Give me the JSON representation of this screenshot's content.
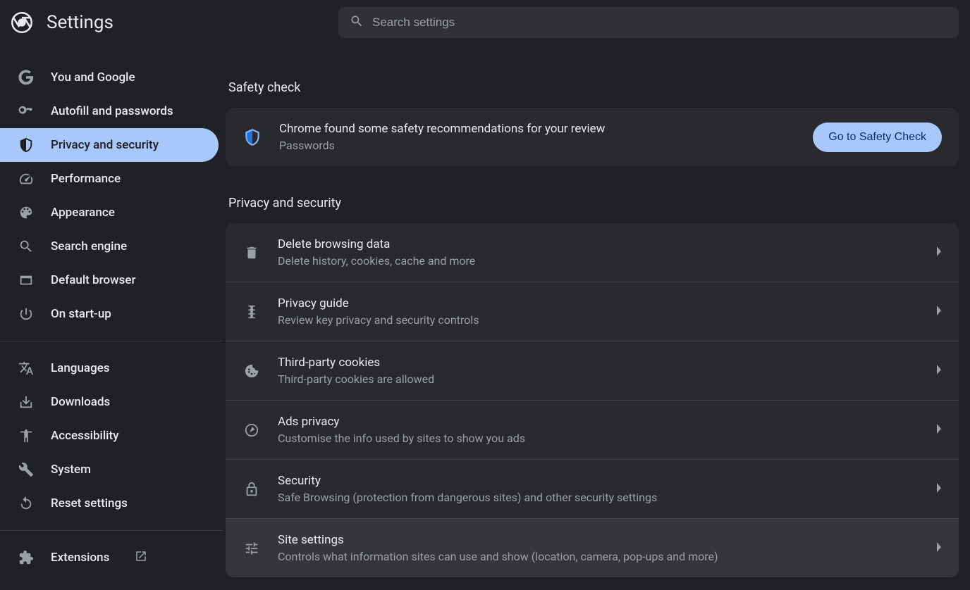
{
  "header": {
    "title": "Settings",
    "search_placeholder": "Search settings"
  },
  "sidebar": {
    "items": [
      {
        "id": "you-google",
        "label": "You and Google",
        "icon": "google"
      },
      {
        "id": "autofill",
        "label": "Autofill and passwords",
        "icon": "key"
      },
      {
        "id": "privacy",
        "label": "Privacy and security",
        "icon": "shield",
        "active": true
      },
      {
        "id": "performance",
        "label": "Performance",
        "icon": "speed"
      },
      {
        "id": "appearance",
        "label": "Appearance",
        "icon": "palette"
      },
      {
        "id": "search-engine",
        "label": "Search engine",
        "icon": "search"
      },
      {
        "id": "default-browser",
        "label": "Default browser",
        "icon": "browser"
      },
      {
        "id": "on-startup",
        "label": "On start-up",
        "icon": "power"
      }
    ],
    "items2": [
      {
        "id": "languages",
        "label": "Languages",
        "icon": "translate"
      },
      {
        "id": "downloads",
        "label": "Downloads",
        "icon": "download"
      },
      {
        "id": "accessibility",
        "label": "Accessibility",
        "icon": "accessibility"
      },
      {
        "id": "system",
        "label": "System",
        "icon": "wrench"
      },
      {
        "id": "reset",
        "label": "Reset settings",
        "icon": "reset"
      }
    ],
    "items3": [
      {
        "id": "extensions",
        "label": "Extensions",
        "icon": "extension",
        "launch": true
      }
    ]
  },
  "content": {
    "safety_check_title": "Safety check",
    "safety_card": {
      "title": "Chrome found some safety recommendations for your review",
      "sub": "Passwords",
      "button": "Go to Safety Check"
    },
    "privacy_title": "Privacy and security",
    "rows": [
      {
        "id": "delete-browsing",
        "title": "Delete browsing data",
        "sub": "Delete history, cookies, cache and more",
        "icon": "trash"
      },
      {
        "id": "privacy-guide",
        "title": "Privacy guide",
        "sub": "Review key privacy and security controls",
        "icon": "guide"
      },
      {
        "id": "third-party-cookies",
        "title": "Third-party cookies",
        "sub": "Third-party cookies are allowed",
        "icon": "cookie"
      },
      {
        "id": "ads-privacy",
        "title": "Ads privacy",
        "sub": "Customise the info used by sites to show you ads",
        "icon": "ads"
      },
      {
        "id": "security",
        "title": "Security",
        "sub": "Safe Browsing (protection from dangerous sites) and other security settings",
        "icon": "lock"
      },
      {
        "id": "site-settings",
        "title": "Site settings",
        "sub": "Controls what information sites can use and show (location, camera, pop-ups and more)",
        "icon": "tune",
        "highlight": true
      }
    ]
  }
}
